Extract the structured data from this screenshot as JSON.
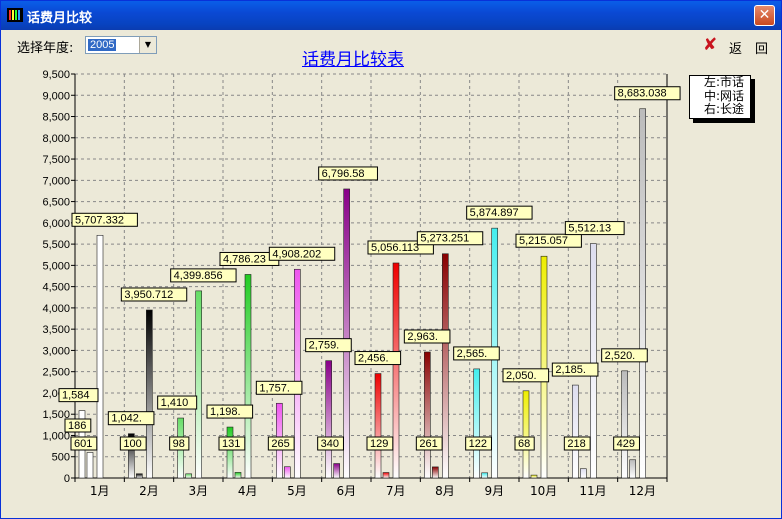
{
  "window": {
    "title": "话费月比较"
  },
  "toolbar": {
    "year_label": "选择年度:",
    "year_value": "2005",
    "back_label": "返　回"
  },
  "chart_data": {
    "type": "bar",
    "title": "话费月比较表",
    "categories": [
      "1月",
      "2月",
      "3月",
      "4月",
      "5月",
      "6月",
      "7月",
      "8月",
      "9月",
      "10月",
      "11月",
      "12月"
    ],
    "series": [
      {
        "name": "市话",
        "values": [
          1584,
          1042,
          1410,
          1198,
          1757,
          2759,
          2456,
          2963,
          2565,
          2050,
          2185,
          2520
        ]
      },
      {
        "name": "网话",
        "values": [
          601,
          100,
          98,
          131,
          265,
          340,
          129,
          261,
          122,
          68,
          218,
          429
        ]
      },
      {
        "name": "长途",
        "values": [
          5707.332,
          3950.712,
          4399.856,
          4786.23,
          4908.202,
          6796.58,
          5056.113,
          5273.251,
          5874.897,
          5215.057,
          5512.13,
          8683.038
        ]
      }
    ],
    "data_labels": {
      "left": [
        "1,584",
        "1,042.",
        "1,410",
        "1,198.",
        "1,757.",
        "2,759.",
        "2,456.",
        "2,963.",
        "2,565.",
        "2,050.",
        "2,185.",
        "2,520."
      ],
      "mid": [
        "601",
        "100",
        "98",
        "131",
        "265",
        "340",
        "129",
        "261",
        "122",
        "68",
        "218",
        "429"
      ],
      "right": [
        "5,707.332",
        "3,950.712",
        "4,399.856",
        "4,786.23",
        "4,908.202",
        "6,796.58",
        "5,056.113",
        "5,273.251",
        "5,874.897",
        "5,215.057",
        "5,512.13",
        "8,683.038"
      ],
      "left_extra": [
        "186",
        "",
        "",
        "",
        "",
        "",
        "",
        "",
        "",
        "",
        "",
        ""
      ]
    },
    "ylim": [
      0,
      9500
    ],
    "yticks": [
      "0",
      "500",
      "1,000",
      "1,500",
      "2,000",
      "2,500",
      "3,000",
      "3,500",
      "4,000",
      "4,500",
      "5,000",
      "5,500",
      "6,000",
      "6,500",
      "7,000",
      "7,500",
      "8,000",
      "8,500",
      "9,000",
      "9,500"
    ],
    "grid": true,
    "legend_position": "top-right",
    "legend": [
      "左:市话",
      "中:网话",
      "右:长途"
    ],
    "month_colors": [
      "#ffffff",
      "#000000",
      "#66dd66",
      "#22cc22",
      "#ee55ee",
      "#880088",
      "#ee0000",
      "#880000",
      "#44eeee",
      "#eeee00",
      "#ddddee",
      "#bbbbbb"
    ]
  }
}
